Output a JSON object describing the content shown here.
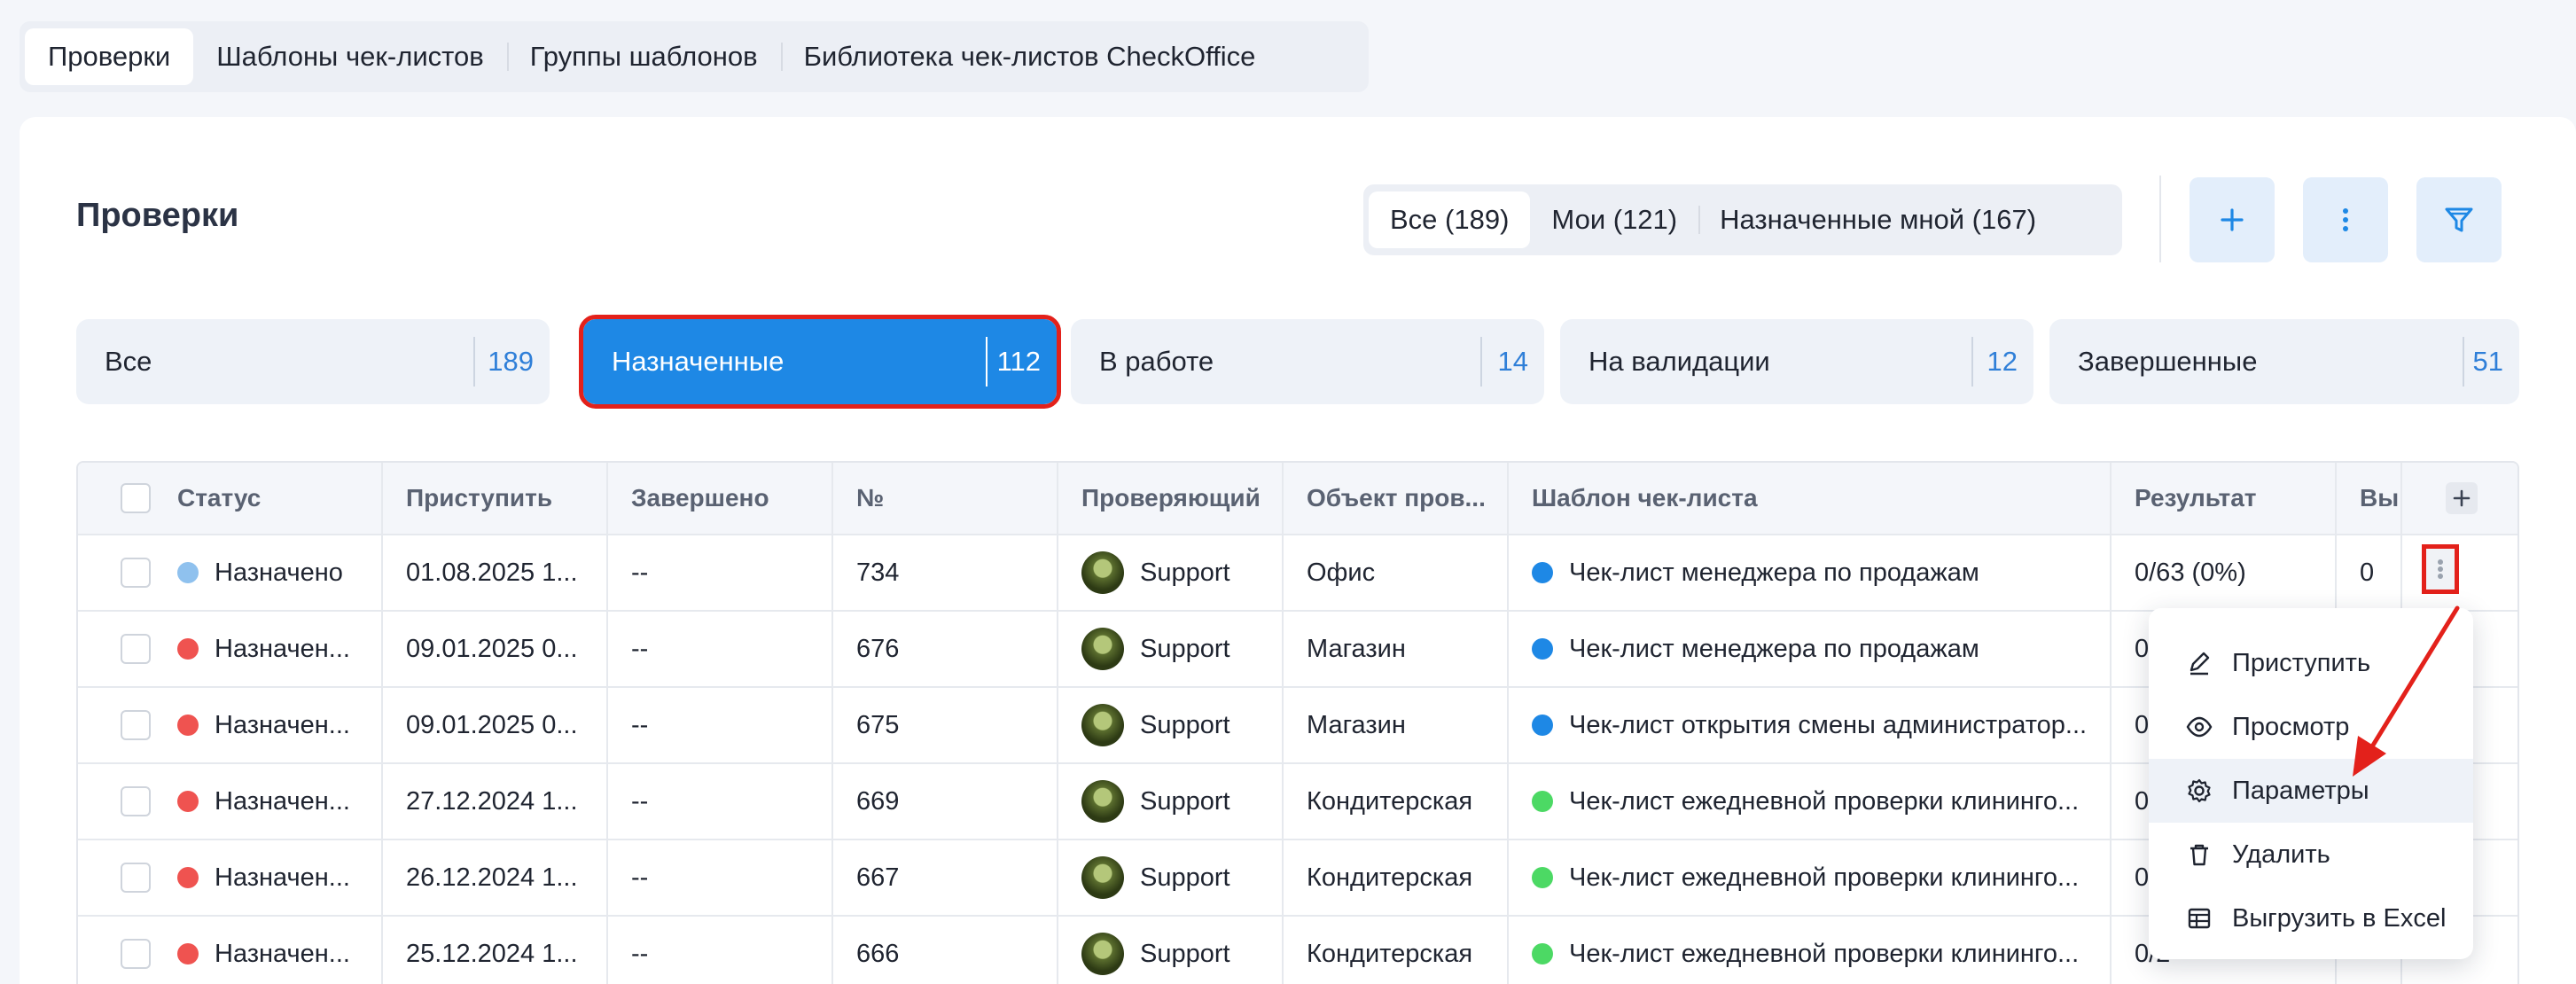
{
  "top_tabs": [
    {
      "label": "Проверки",
      "active": true
    },
    {
      "label": "Шаблоны чек-листов",
      "active": false
    },
    {
      "label": "Группы шаблонов",
      "active": false
    },
    {
      "label": "Библиотека чек-листов CheckOffice",
      "active": false
    }
  ],
  "header": {
    "title": "Проверки",
    "scope_tabs": [
      {
        "label": "Все (189)",
        "active": true
      },
      {
        "label": "Мои (121)",
        "active": false
      },
      {
        "label": "Назначенные мной (167)",
        "active": false
      }
    ],
    "buttons": [
      "plus-icon",
      "more-vertical-icon",
      "filter-icon"
    ]
  },
  "status_filters": [
    {
      "label": "Все",
      "count": "189",
      "active": false
    },
    {
      "label": "Назначенные",
      "count": "112",
      "active": true
    },
    {
      "label": "В работе",
      "count": "14",
      "active": false
    },
    {
      "label": "На валидации",
      "count": "12",
      "active": false
    },
    {
      "label": "Завершенные",
      "count": "51",
      "active": false
    }
  ],
  "table": {
    "columns": [
      "Статус",
      "Приступить",
      "Завершено",
      "№",
      "Проверяющий",
      "Объект пров...",
      "Шаблон чек-листа",
      "Результат",
      "Вып"
    ],
    "rows": [
      {
        "status": "Назначено",
        "status_color": "#8fc1ee",
        "start": "01.08.2025 1...",
        "done": "--",
        "num": "734",
        "inspector": "Support",
        "object": "Офис",
        "template": "Чек-лист менеджера по продажам",
        "template_color": "#1e88e5",
        "result": "0/63 (0%)",
        "extra": "0"
      },
      {
        "status": "Назначен...",
        "status_color": "#ef5350",
        "start": "09.01.2025 0...",
        "done": "--",
        "num": "676",
        "inspector": "Support",
        "object": "Магазин",
        "template": "Чек-лист менеджера по продажам",
        "template_color": "#1e88e5",
        "result": "0/6",
        "extra": ""
      },
      {
        "status": "Назначен...",
        "status_color": "#ef5350",
        "start": "09.01.2025 0...",
        "done": "--",
        "num": "675",
        "inspector": "Support",
        "object": "Магазин",
        "template": "Чек-лист открытия смены администратор...",
        "template_color": "#1e88e5",
        "result": "0/",
        "extra": ""
      },
      {
        "status": "Назначен...",
        "status_color": "#ef5350",
        "start": "27.12.2024 1...",
        "done": "--",
        "num": "669",
        "inspector": "Support",
        "object": "Кондитерская",
        "template": "Чек-лист ежедневной проверки клининго...",
        "template_color": "#4cd964",
        "result": "0/",
        "extra": ""
      },
      {
        "status": "Назначен...",
        "status_color": "#ef5350",
        "start": "26.12.2024 1...",
        "done": "--",
        "num": "667",
        "inspector": "Support",
        "object": "Кондитерская",
        "template": "Чек-лист ежедневной проверки клининго...",
        "template_color": "#4cd964",
        "result": "0/",
        "extra": ""
      },
      {
        "status": "Назначен...",
        "status_color": "#ef5350",
        "start": "25.12.2024 1...",
        "done": "--",
        "num": "666",
        "inspector": "Support",
        "object": "Кондитерская",
        "template": "Чек-лист ежедневной проверки клининго...",
        "template_color": "#4cd964",
        "result": "0/2",
        "extra": ""
      }
    ]
  },
  "context_menu": {
    "items": [
      {
        "label": "Приступить",
        "icon": "pencil-icon"
      },
      {
        "label": "Просмотр",
        "icon": "eye-icon"
      },
      {
        "label": "Параметры",
        "icon": "gear-icon",
        "hover": true
      },
      {
        "label": "Удалить",
        "icon": "trash-icon"
      },
      {
        "label": "Выгрузить в Excel",
        "icon": "table-icon"
      }
    ]
  },
  "colors": {
    "accent": "#1e88e5",
    "highlight": "#e3211b",
    "status_assigned": "#8fc1ee",
    "status_overdue": "#ef5350"
  }
}
